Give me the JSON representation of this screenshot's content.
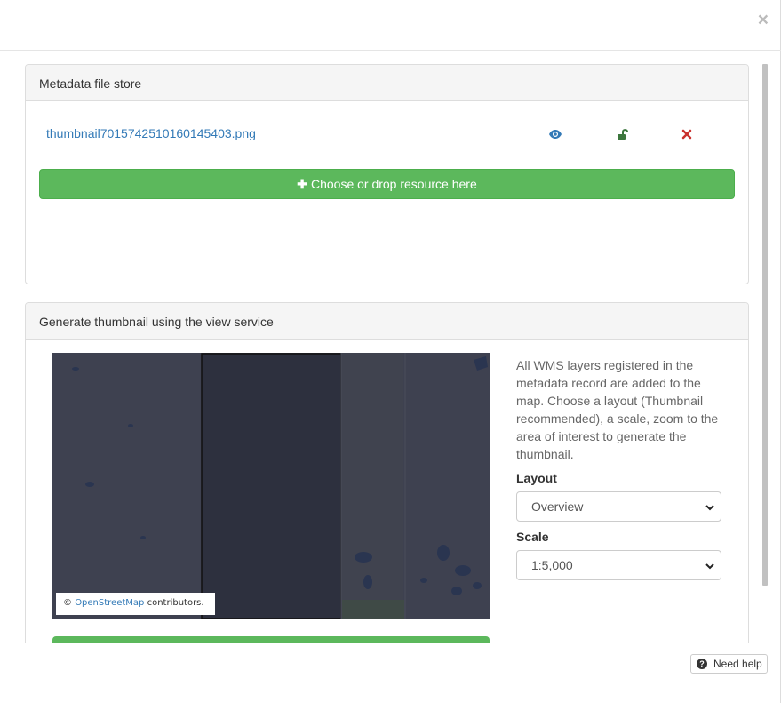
{
  "modal": {
    "close_symbol": "×"
  },
  "file_store": {
    "heading": "Metadata file store",
    "files": [
      {
        "name": "thumbnail7015742510160145403.png",
        "actions": [
          "eye-icon",
          "unlock-icon",
          "remove-icon"
        ]
      }
    ],
    "drop_button_label": "Choose or drop resource here"
  },
  "thumbnail": {
    "heading": "Generate thumbnail using the view service",
    "description": "All WMS layers registered in the metadata record are added to the map. Choose a layout (Thumbnail recommended), a scale, zoom to the area of interest to generate the thumbnail.",
    "attribution": {
      "prefix": "©",
      "link": "OpenStreetMap",
      "suffix": "contributors."
    },
    "layout_label": "Layout",
    "layout_value": "Overview",
    "scale_label": "Scale",
    "scale_value": "1:5,000"
  },
  "help_button": "Need help",
  "colors": {
    "success": "#5cb85c",
    "link": "#337ab7",
    "danger": "#c9302c",
    "unlock": "#3c763d",
    "map_bg": "#3c3f4d"
  }
}
